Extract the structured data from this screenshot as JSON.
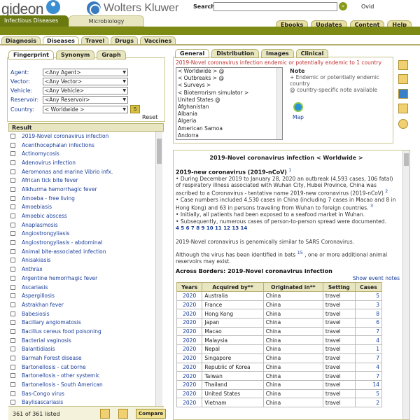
{
  "header": {
    "logo_text": "gideon",
    "partner_text": "Wolters Kluwer",
    "search_label": "Search",
    "search_value": "",
    "user": "Ovid",
    "app_tab": "Infectious Diseases",
    "micro_tab": "Microbiology",
    "top_tabs": [
      "Ebooks",
      "Updates",
      "Content",
      "Help"
    ]
  },
  "nav_tabs": [
    "Diagnosis",
    "Diseases",
    "Travel",
    "Drugs",
    "Vaccines"
  ],
  "filter": {
    "tabs": [
      "Fingerprint",
      "Synonym",
      "Graph"
    ],
    "fields": [
      {
        "label": "Agent:",
        "value": "<Any Agent>"
      },
      {
        "label": "Vector:",
        "value": "<Any Vector>"
      },
      {
        "label": "Vehicle:",
        "value": "<Any Vehicle>"
      },
      {
        "label": "Reservoir:",
        "value": "<Any Reservoir>"
      },
      {
        "label": "Country:",
        "value": "< Worldwide >"
      }
    ],
    "go_label": "S",
    "reset": "Reset"
  },
  "result": {
    "header": "Result",
    "items": [
      "2019-Novel coronavirus infection",
      "Acenthocephalan infections",
      "Actinomycosis",
      "Adenovirus infection",
      "Aeromonas and marine Vibrio infx.",
      "African tick bite fever",
      "Alkhurma hemorrhagic fever",
      "Amoeba - free living",
      "Amoebiasis",
      "Amoebic abscess",
      "Anaplasmosis",
      "Angiostrongyliasis",
      "Angiostrongyliasis - abdominal",
      "Animal bite-associated infection",
      "Anisakiasis",
      "Anthrax",
      "Argentine hemorrhagic fever",
      "Ascariasis",
      "Aspergillosis",
      "Astrakhan fever",
      "Babesiosis",
      "Bacillary angiomatosis",
      "Bacillus cereus food poisoning",
      "Bacterial vaginosis",
      "Balantidiasis",
      "Barmah Forest disease",
      "Bartonellosis - cat borne",
      "Bartonellosis - other systemic",
      "Bartonellosis - South American",
      "Bas-Congo virus",
      "Baylisascariasis"
    ],
    "count": "361 of 361 listed",
    "compare": "Compare"
  },
  "geo": {
    "tabs": [
      "General",
      "Distribution",
      "Images",
      "Clinical"
    ],
    "subtitle": "2019-Novel coronavirus infection endemic or potentially endemic to 1 country",
    "list": [
      "< Worldwide > @",
      "< Outbreaks > @",
      "< Surveys >",
      "< Bioterrorism simulator >",
      "United States @",
      "Afghanistan",
      "Albania",
      "Algeria",
      "American Samoa",
      "Andorra",
      "Angola"
    ],
    "note_title": "Note",
    "note_endemic": "+ Endemic or potentially endemic country",
    "note_at": "@ country-specific note available",
    "map": "Map"
  },
  "content": {
    "title": "2019-Novel coronavirus infection < Worldwide >",
    "heading": "2019-new coronavirus (2019-nCoV)",
    "sup1": "1",
    "para1": "During December 2019 to January 28, 2020 an outbreak (4,593 cases, 106 fatal) of respiratory illness associated with Wuhan City, Hubei Province, China was ascribed to a Coronavirus - tentative name 2019-new coronavirus (2019-nCoV)",
    "sup2": "2",
    "bullet1": "Case numbers included 4,530 cases in China (including 7 cases in Macao and 8 in Hong Kong) and 63 in persons traveling from Wuhan to foreign countries.",
    "sup3": "3",
    "bullet2": "Initially, all patients had been exposed to a seafood market in Wuhan.",
    "bullet3": "Subsequently, numerous cases of person-to-person spread were documented.",
    "refs": "4 5 6 7 8 9 10 11 12 13 14",
    "para2": "2019-Novel coronavirus is genomically similar to SARS Coronavirus.",
    "para3a": "Although the virus has been identified in bats",
    "sup15": "15",
    "para3b": ", one or more additional animal reservoirs may exist.",
    "xb_title": "Across Borders: 2019-Novel coronavirus infection",
    "show_notes": "Show event notes",
    "columns": [
      "Years",
      "Acquired by**",
      "Originated in**",
      "Setting",
      "Cases"
    ],
    "rows": [
      [
        "2020",
        "Australia",
        "China",
        "travel",
        "5"
      ],
      [
        "2020",
        "France",
        "China",
        "travel",
        "3"
      ],
      [
        "2020",
        "Hong Kong",
        "China",
        "travel",
        "8"
      ],
      [
        "2020",
        "Japan",
        "China",
        "travel",
        "6"
      ],
      [
        "2020",
        "Macao",
        "China",
        "travel",
        "7"
      ],
      [
        "2020",
        "Malaysia",
        "China",
        "travel",
        "4"
      ],
      [
        "2020",
        "Nepal",
        "China",
        "travel",
        "1"
      ],
      [
        "2020",
        "Singapore",
        "China",
        "travel",
        "7"
      ],
      [
        "2020",
        "Republic of Korea",
        "China",
        "travel",
        "4"
      ],
      [
        "2020",
        "Taiwan",
        "China",
        "travel",
        "7"
      ],
      [
        "2020",
        "Thailand",
        "China",
        "travel",
        "14"
      ],
      [
        "2020",
        "United States",
        "China",
        "travel",
        "5"
      ],
      [
        "2020",
        "Vietnam",
        "China",
        "travel",
        "2"
      ]
    ]
  },
  "colors": {
    "band": "#7d8a14",
    "tab_bg": "#e8e6c0",
    "link": "#1a3e9a",
    "alert": "#c03030"
  }
}
